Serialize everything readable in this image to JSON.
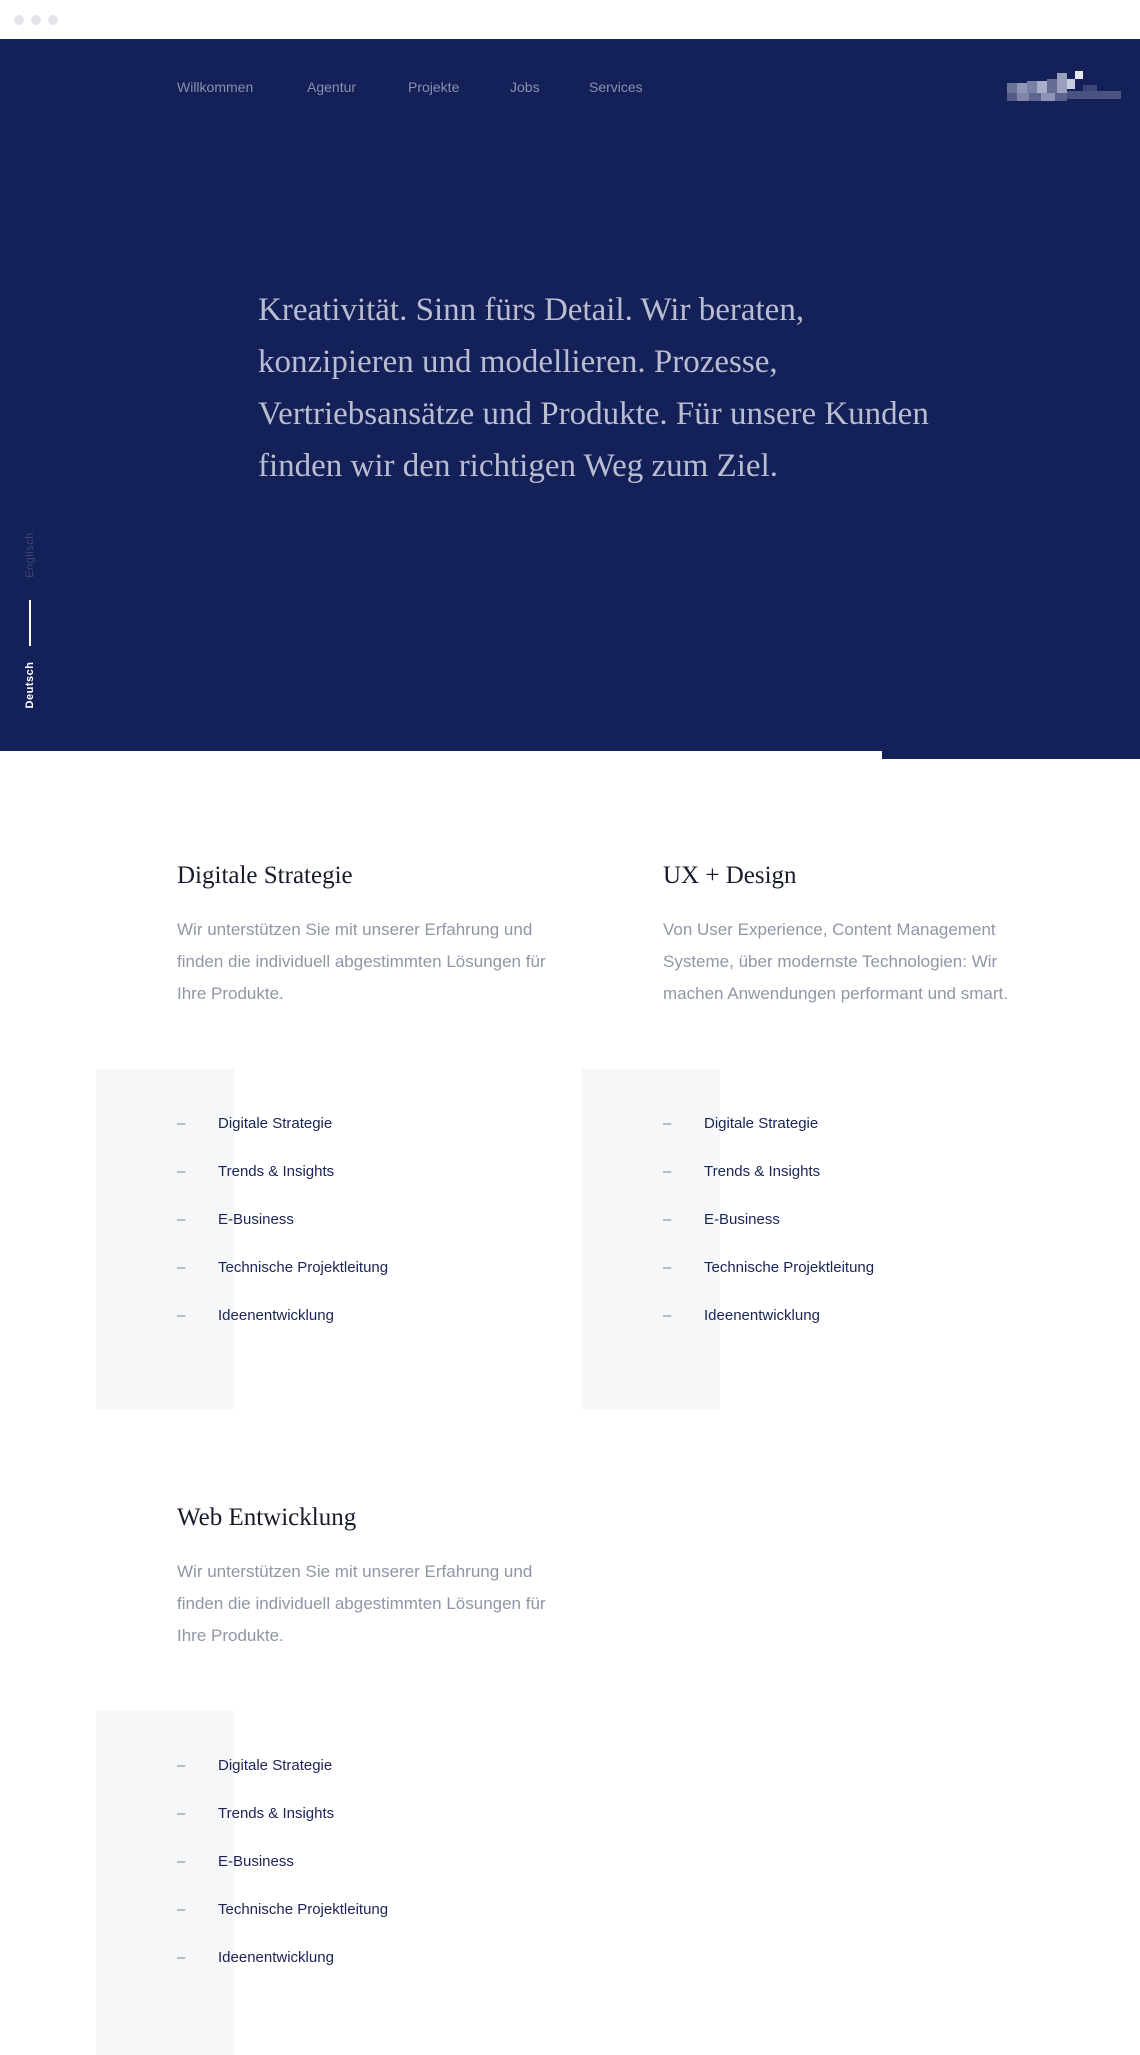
{
  "window": {
    "controls": [
      "close",
      "minimize",
      "maximize"
    ]
  },
  "nav": {
    "items": [
      {
        "label": "Willkommen"
      },
      {
        "label": "Agentur"
      },
      {
        "label": "Projekte"
      },
      {
        "label": "Jobs"
      },
      {
        "label": "Services"
      }
    ]
  },
  "hero": {
    "text": "Kreativität. Sinn fürs Detail. Wir beraten, konzipieren und modellieren. Prozesse, Vertriebsansätze und Produkte. Für unsere Kunden finden wir den richtigen Weg zum Ziel."
  },
  "language": {
    "inactive": "Englisch",
    "active": "Deutsch"
  },
  "sections": [
    {
      "title": "Digitale Strategie",
      "description": "Wir unterstützen Sie mit unserer Erfahrung und finden die individuell abgestimmten Lösungen für Ihre Produkte.",
      "items": [
        "Digitale Strategie",
        "Trends & Insights",
        "E-Business",
        "Technische Projektleitung",
        "Ideenentwicklung"
      ]
    },
    {
      "title": "UX + Design",
      "description": "Von User Experience, Content Management Systeme, über modernste Technologien: Wir machen Anwendungen performant und smart.",
      "items": [
        "Digitale Strategie",
        "Trends & Insights",
        "E-Business",
        "Technische Projektleitung",
        "Ideenentwicklung"
      ]
    },
    {
      "title": "Web Entwicklung",
      "description": "Wir unterstützen Sie mit unserer Erfahrung und finden die individuell abgestimmten Lösungen für Ihre Produkte.",
      "items": [
        "Digitale Strategie",
        "Trends & Insights",
        "E-Business",
        "Technische Projektleitung",
        "Ideenentwicklung"
      ]
    }
  ],
  "list_marker": "–",
  "colors": {
    "hero_bg": "#142158",
    "accent_text": "#1a2456",
    "panel_bg": "#f6f7f9",
    "muted_text": "#9096a6"
  },
  "icons": {
    "logo": "pixelated-logo"
  }
}
